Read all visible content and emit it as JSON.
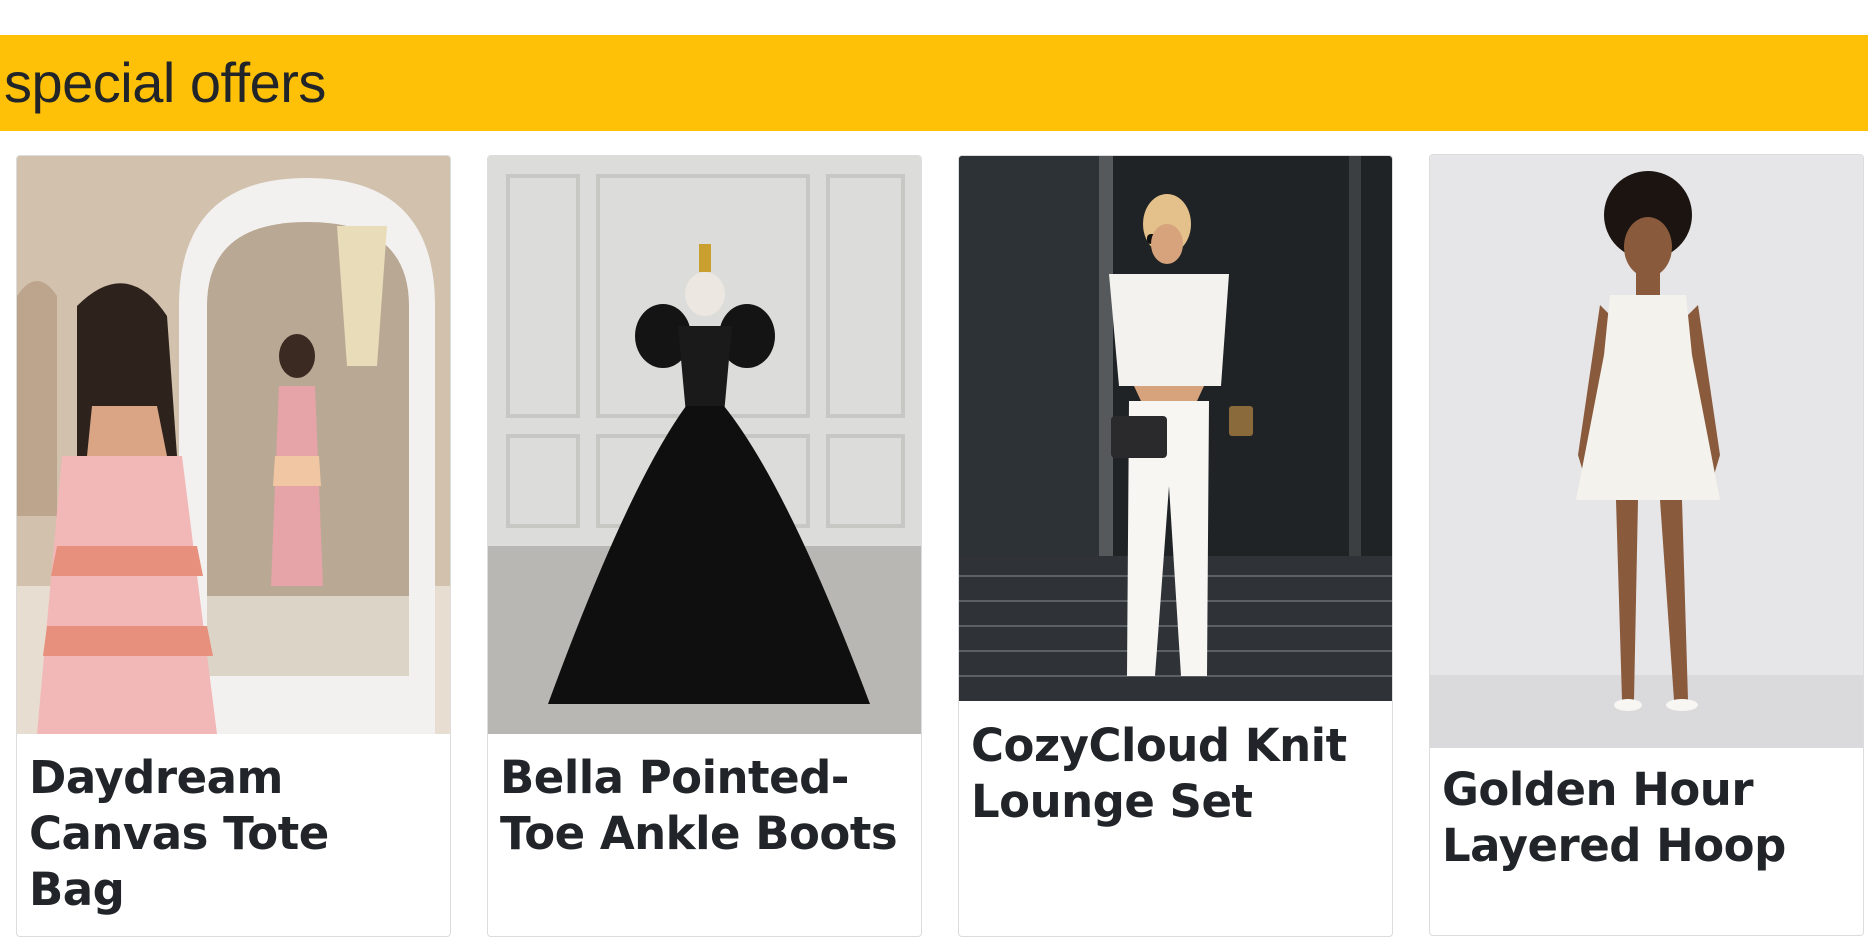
{
  "section": {
    "title": "special offers",
    "accent_color": "#ffc107"
  },
  "products": [
    {
      "name": "Daydream Canvas Tote Bag",
      "image": "woman-in-floral-dress-mirror-photo"
    },
    {
      "name": "Bella Pointed-Toe Ankle Boots",
      "image": "black-ball-gown-on-mannequin-photo"
    },
    {
      "name": "CozyCloud Knit Lounge Set",
      "image": "woman-in-white-outfit-sunglasses-photo"
    },
    {
      "name": "Golden Hour Layered Hoop",
      "image": "model-in-white-mini-dress-photo"
    }
  ]
}
